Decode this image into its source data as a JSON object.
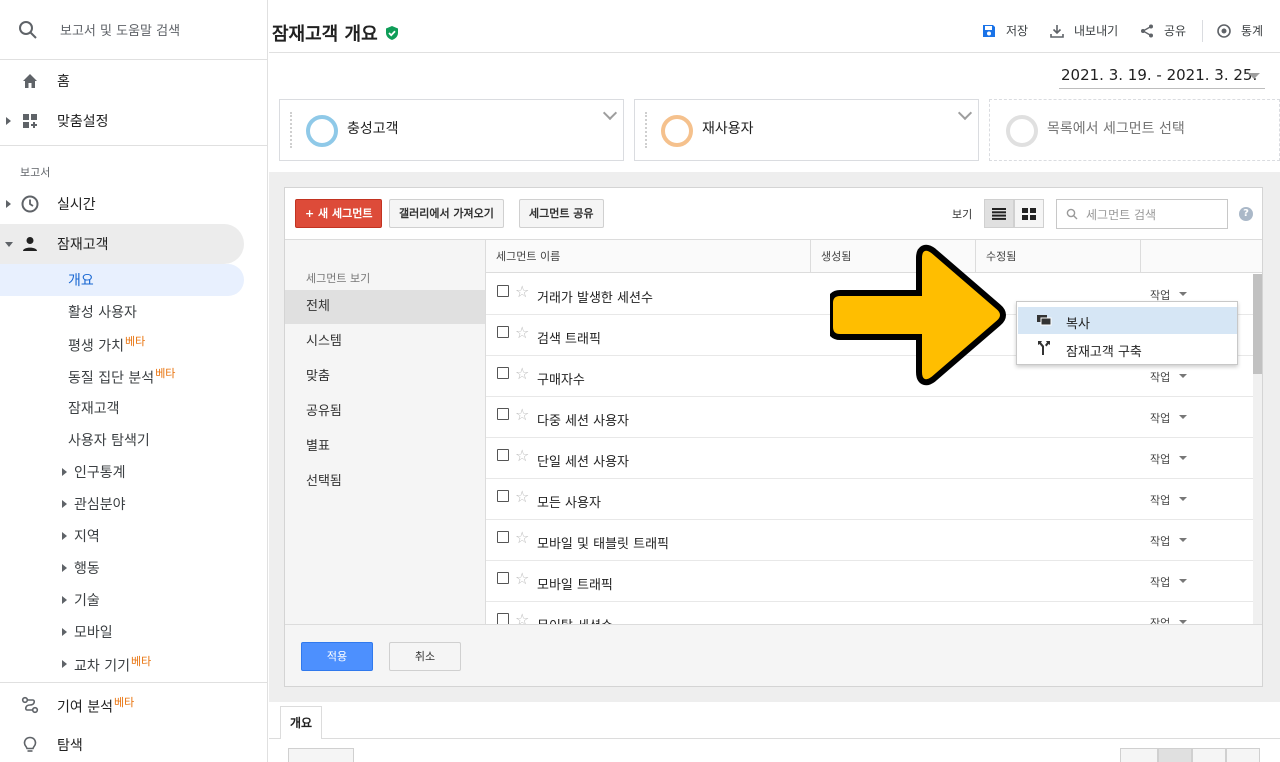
{
  "sidebar": {
    "search_placeholder": "보고서 및 도움말 검색",
    "home": "홈",
    "customization": "맞춤설정",
    "reports_section": "보고서",
    "realtime": "실시간",
    "audience": "잠재고객",
    "audience_sub": [
      {
        "label": "개요"
      },
      {
        "label": "활성 사용자"
      },
      {
        "label": "평생 가치",
        "beta": "베타"
      },
      {
        "label": "동질 집단 분석",
        "beta": "베타"
      },
      {
        "label": "잠재고객"
      },
      {
        "label": "사용자 탐색기"
      },
      {
        "label": "인구통계"
      },
      {
        "label": "관심분야"
      },
      {
        "label": "지역"
      },
      {
        "label": "행동"
      },
      {
        "label": "기술"
      },
      {
        "label": "모바일"
      },
      {
        "label": "교차 기기",
        "beta": "베타"
      }
    ],
    "attribution": "기여 분석",
    "attribution_beta": "베타",
    "discover": "탐색"
  },
  "header": {
    "title": "잠재고객 개요",
    "save": "저장",
    "export": "내보내기",
    "share": "공유",
    "insights": "통계"
  },
  "date_range": "2021. 3. 19. - 2021. 3. 25.",
  "segments": {
    "card1": {
      "name": "충성고객",
      "color": "#8fc9e8"
    },
    "card2": {
      "name": "재사용자",
      "color": "#f5c18d"
    },
    "card3": {
      "name": "목록에서 세그먼트 선택",
      "color": "#e0e0e0"
    }
  },
  "toolbar": {
    "new_segment": "+ 새 세그먼트",
    "import_gallery": "갤러리에서 가져오기",
    "share_segment": "세그먼트 공유",
    "view_label": "보기",
    "search_placeholder": "세그먼트 검색",
    "help": "?"
  },
  "filters": {
    "heading": "세그먼트 보기",
    "items": [
      "전체",
      "시스템",
      "맞춤",
      "공유됨",
      "별표",
      "선택됨"
    ]
  },
  "table": {
    "headers": [
      "세그먼트 이름",
      "생성됨",
      "수정됨"
    ],
    "action_label": "작업",
    "rows": [
      "거래가 발생한 세션수",
      "검색 트래픽",
      "구매자수",
      "다중 세션 사용자",
      "단일 세션 사용자",
      "모든 사용자",
      "모바일 및 태블릿 트래픽",
      "모바일 트래픽",
      "무이탈 세션수"
    ]
  },
  "dropdown": {
    "copy": "복사",
    "build_audience": "잠재고객 구축"
  },
  "footer": {
    "apply": "적용",
    "cancel": "취소"
  },
  "bottom_tab": "개요",
  "colors": {
    "accent_red": "#dd4b39",
    "accent_blue": "#4d90fe",
    "arrow_yellow": "#ffc107"
  }
}
